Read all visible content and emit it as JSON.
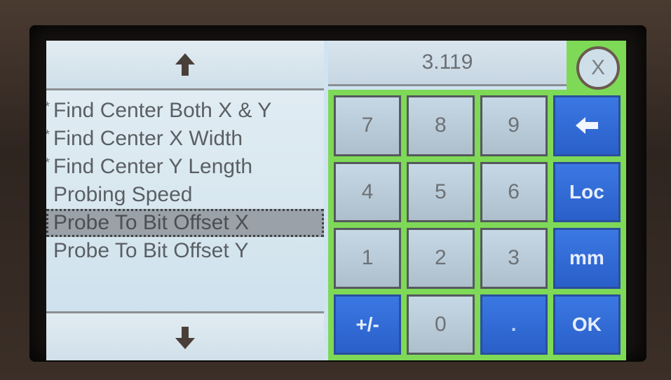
{
  "display": {
    "value": "3.119",
    "close_label": "X"
  },
  "menu": {
    "items": [
      {
        "label": "Find Center Both X & Y",
        "marker": "*"
      },
      {
        "label": "Find Center X Width",
        "marker": "*"
      },
      {
        "label": "Find Center Y Length",
        "marker": "*"
      },
      {
        "label": "Probing Speed",
        "marker": ""
      },
      {
        "label": "Probe To Bit Offset X",
        "marker": "",
        "selected": true
      },
      {
        "label": "Probe To Bit Offset Y",
        "marker": ""
      }
    ]
  },
  "keypad": {
    "keys": [
      {
        "label": "7"
      },
      {
        "label": "8"
      },
      {
        "label": "9"
      },
      {
        "label": "",
        "icon": "left-arrow-icon"
      },
      {
        "label": "4"
      },
      {
        "label": "5"
      },
      {
        "label": "6"
      },
      {
        "label": "Loc"
      },
      {
        "label": "1"
      },
      {
        "label": "2"
      },
      {
        "label": "3"
      },
      {
        "label": "mm"
      },
      {
        "label": "+/-"
      },
      {
        "label": "0"
      },
      {
        "label": "."
      },
      {
        "label": "OK"
      }
    ]
  },
  "icons": {
    "scroll_up": "up-arrow-icon",
    "scroll_down": "down-arrow-icon"
  },
  "colors": {
    "keypad_bg": "#7ed957",
    "blue_key": "#3b78e3",
    "selected_row": "#9aa1a8"
  }
}
